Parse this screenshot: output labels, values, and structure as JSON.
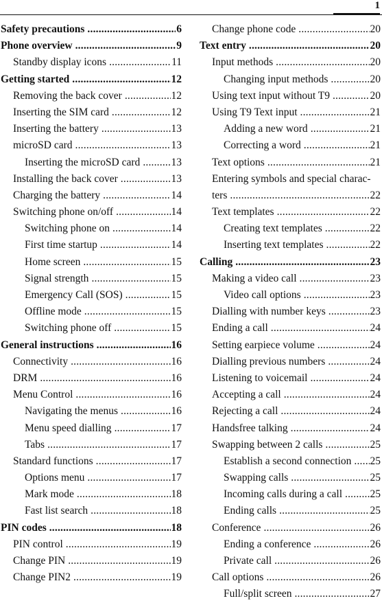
{
  "header": {
    "page_number": "1"
  },
  "toc": {
    "left": [
      {
        "level": 1,
        "title": "Safety precautions",
        "page": "6"
      },
      {
        "level": 1,
        "title": "Phone overview",
        "page": "9"
      },
      {
        "level": 2,
        "title": "Standby display icons",
        "page": "11"
      },
      {
        "level": 1,
        "title": "Getting started",
        "page": "12"
      },
      {
        "level": 2,
        "title": "Removing the back cover",
        "page": "12"
      },
      {
        "level": 2,
        "title": "Inserting the SIM card",
        "page": "12"
      },
      {
        "level": 2,
        "title": "Inserting the battery",
        "page": "13"
      },
      {
        "level": 2,
        "title": "microSD card",
        "page": "13"
      },
      {
        "level": 3,
        "title": "Inserting the microSD card",
        "page": "13"
      },
      {
        "level": 2,
        "title": "Installing the back cover",
        "page": "13"
      },
      {
        "level": 2,
        "title": "Charging the battery",
        "page": "14"
      },
      {
        "level": 2,
        "title": "Switching phone on/off",
        "page": "14"
      },
      {
        "level": 3,
        "title": "Switching phone on",
        "page": "14"
      },
      {
        "level": 3,
        "title": "First time startup",
        "page": "14"
      },
      {
        "level": 3,
        "title": "Home screen",
        "page": "15"
      },
      {
        "level": 3,
        "title": "Signal strength",
        "page": "15"
      },
      {
        "level": 3,
        "title": "Emergency Call (SOS)",
        "page": "15"
      },
      {
        "level": 3,
        "title": "Offline mode",
        "page": "15"
      },
      {
        "level": 3,
        "title": "Switching phone off",
        "page": "15"
      },
      {
        "level": 1,
        "title": "General instructions",
        "page": "16"
      },
      {
        "level": 2,
        "title": "Connectivity",
        "page": "16"
      },
      {
        "level": 2,
        "title": "DRM",
        "page": "16"
      },
      {
        "level": 2,
        "title": "Menu Control",
        "page": "16"
      },
      {
        "level": 3,
        "title": "Navigating the menus",
        "page": "16"
      },
      {
        "level": 3,
        "title": "Menu speed dialling",
        "page": "17"
      },
      {
        "level": 3,
        "title": "Tabs",
        "page": "17"
      },
      {
        "level": 2,
        "title": "Standard functions",
        "page": "17"
      },
      {
        "level": 3,
        "title": "Options menu",
        "page": "17"
      },
      {
        "level": 3,
        "title": "Mark mode",
        "page": "18"
      },
      {
        "level": 3,
        "title": "Fast list search",
        "page": "18"
      },
      {
        "level": 1,
        "title": "PIN codes",
        "page": "18"
      },
      {
        "level": 2,
        "title": "PIN control",
        "page": "19"
      },
      {
        "level": 2,
        "title": "Change PIN",
        "page": "19"
      },
      {
        "level": 2,
        "title": "Change PIN2",
        "page": "19"
      }
    ],
    "right": [
      {
        "level": 2,
        "title": "Change phone code",
        "page": "20"
      },
      {
        "level": 1,
        "title": "Text entry",
        "page": "20"
      },
      {
        "level": 2,
        "title": "Input methods",
        "page": "20"
      },
      {
        "level": 3,
        "title": "Changing input methods",
        "page": "20"
      },
      {
        "level": 2,
        "title": "Using text input without T9",
        "page": "20"
      },
      {
        "level": 2,
        "title": "Using T9 Text input",
        "page": "21"
      },
      {
        "level": 3,
        "title": "Adding a new word",
        "page": "21"
      },
      {
        "level": 3,
        "title": "Correcting a word",
        "page": "21"
      },
      {
        "level": 2,
        "title": "Text options",
        "page": "21"
      },
      {
        "level": 2,
        "title": "Entering symbols and special charac-",
        "page": ""
      },
      {
        "level": 2,
        "title": "ters",
        "page": "22"
      },
      {
        "level": 2,
        "title": "Text templates",
        "page": "22"
      },
      {
        "level": 3,
        "title": "Creating text templates",
        "page": "22"
      },
      {
        "level": 3,
        "title": "Inserting text templates",
        "page": "22"
      },
      {
        "level": 1,
        "title": "Calling",
        "page": "23"
      },
      {
        "level": 2,
        "title": "Making a video call",
        "page": "23"
      },
      {
        "level": 3,
        "title": "Video call options",
        "page": "23"
      },
      {
        "level": 2,
        "title": "Dialling with number keys",
        "page": "23"
      },
      {
        "level": 2,
        "title": "Ending a call",
        "page": "24"
      },
      {
        "level": 2,
        "title": "Setting earpiece volume",
        "page": "24"
      },
      {
        "level": 2,
        "title": "Dialling previous numbers",
        "page": "24"
      },
      {
        "level": 2,
        "title": "Listening to voicemail",
        "page": "24"
      },
      {
        "level": 2,
        "title": "Accepting a call",
        "page": "24"
      },
      {
        "level": 2,
        "title": "Rejecting a call",
        "page": "24"
      },
      {
        "level": 2,
        "title": "Handsfree talking",
        "page": "24"
      },
      {
        "level": 2,
        "title": "Swapping between 2 calls",
        "page": "25"
      },
      {
        "level": 3,
        "title": "Establish a second connection",
        "page": "25"
      },
      {
        "level": 3,
        "title": "Swapping calls",
        "page": "25"
      },
      {
        "level": 3,
        "title": "Incoming calls during a call",
        "page": "25"
      },
      {
        "level": 3,
        "title": "Ending calls",
        "page": "25"
      },
      {
        "level": 2,
        "title": "Conference",
        "page": "26"
      },
      {
        "level": 3,
        "title": "Ending a conference",
        "page": "26"
      },
      {
        "level": 3,
        "title": "Private call",
        "page": "26"
      },
      {
        "level": 2,
        "title": "Call options",
        "page": "26"
      },
      {
        "level": 3,
        "title": "Full/split screen",
        "page": "27"
      }
    ]
  }
}
